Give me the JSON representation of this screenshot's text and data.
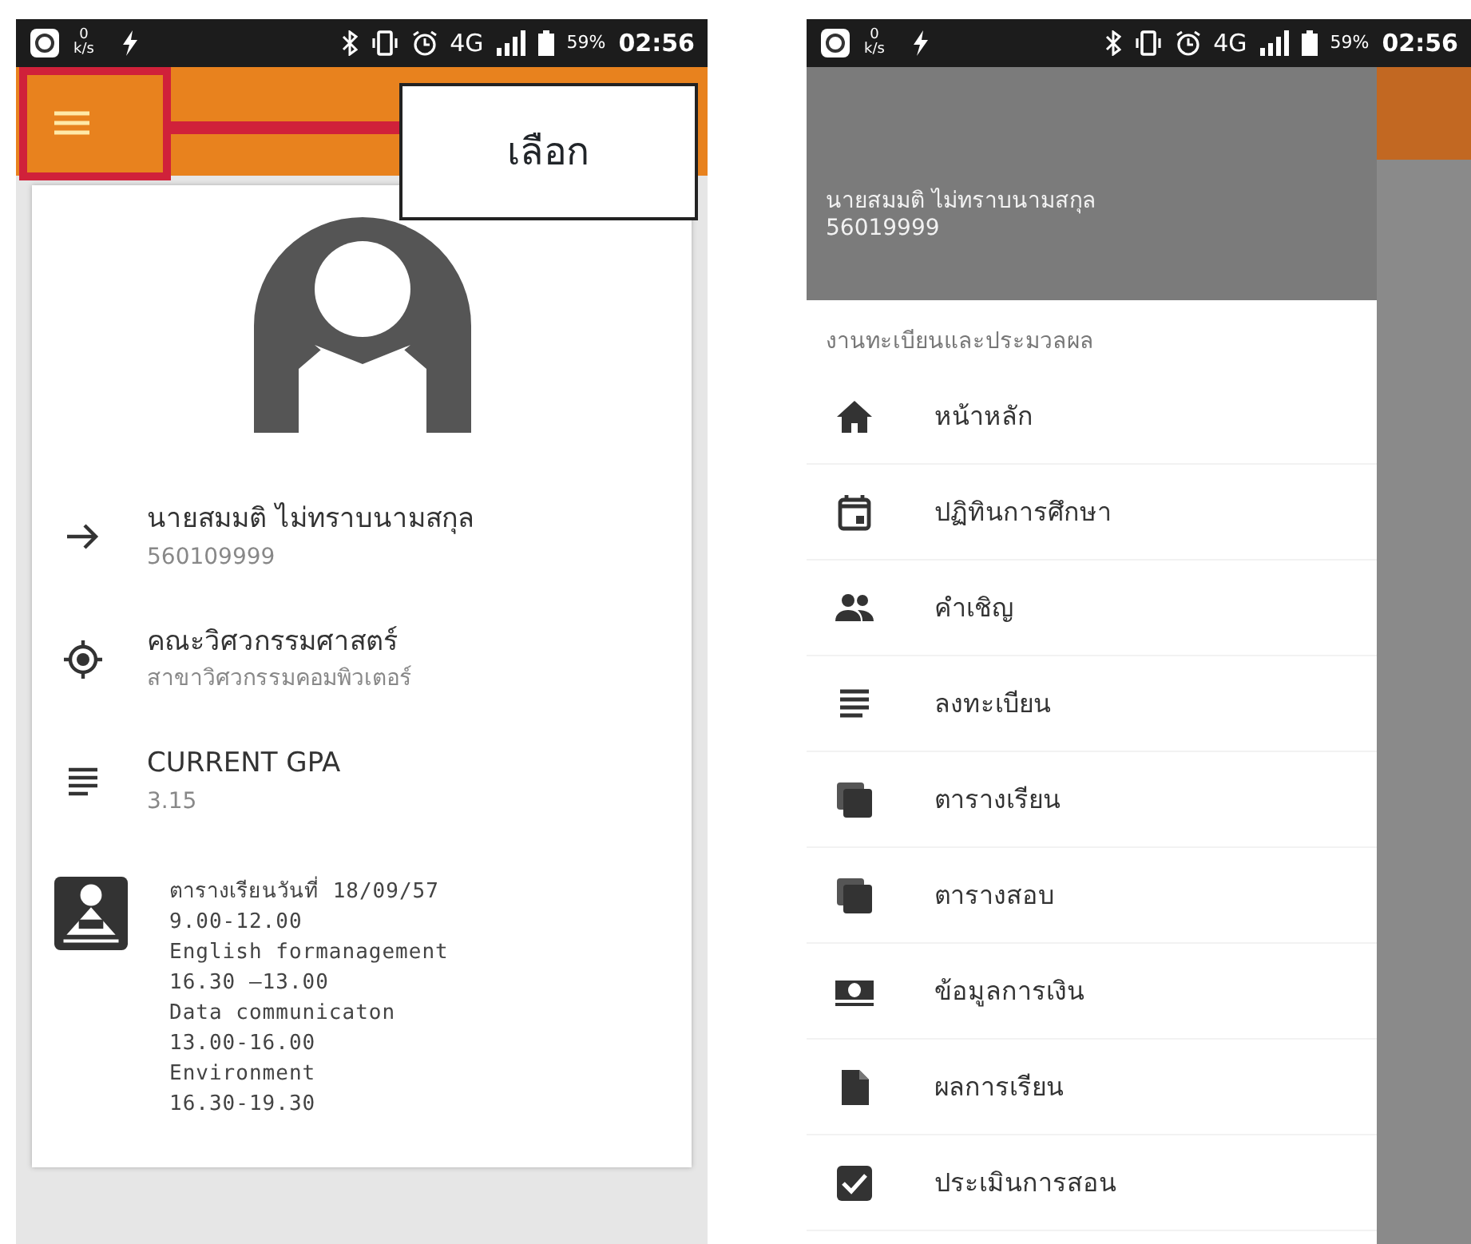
{
  "main_screen": {
    "status_bar": {
      "speed": "0",
      "speed_unit": "k/s",
      "network": "4G",
      "battery": "59%",
      "time": "02:56"
    },
    "info_items": [
      {
        "kind": "plain",
        "title": "นายสมมติ ไม่ทราบนามสกุล",
        "subtitle": "560109999"
      },
      {
        "kind": "plain",
        "title": "คณะวิศวกรรมศาสตร์",
        "subtitle": "สาขาวิศวกรรมคอมพิวเตอร์"
      },
      {
        "kind": "plain",
        "title": "CURRENT GPA",
        "subtitle": "3.15"
      },
      {
        "kind": "schedule",
        "lines": [
          "ตารางเรียนวันที่ 18/09/57",
          "9.00-12.00",
          "English formanagement",
          "16.30 –13.00",
          "Data communicaton",
          "13.00-16.00",
          "Environment",
          "16.30-19.30"
        ]
      }
    ]
  },
  "annotation": {
    "callout": "เลือก"
  },
  "drawer_screen": {
    "status_bar": {
      "speed": "0",
      "speed_unit": "k/s",
      "network": "4G",
      "battery": "59%",
      "time": "02:56"
    },
    "user_name": "นายสมมติ ไม่ทราบนามสกุล",
    "user_id": "56019999",
    "section": "งานทะเบียนและประมวลผล",
    "items": [
      "หน้าหลัก",
      "ปฏิทินการศึกษา",
      "คำเชิญ",
      "ลงทะเบียน",
      "ตารางเรียน",
      "ตารางสอบ",
      "ข้อมูลการเงิน",
      "ผลการเรียน",
      "ประเมินการสอน"
    ]
  }
}
